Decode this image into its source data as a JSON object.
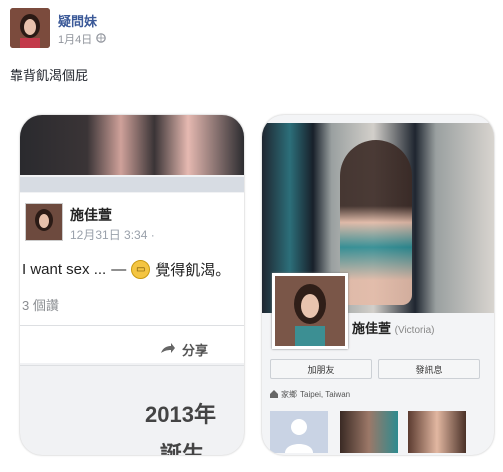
{
  "post": {
    "author": "疑問妹",
    "date": "1月4日",
    "text": "靠背飢渴個屁"
  },
  "left_screenshot": {
    "name": "施佳萱",
    "date": "12月31日 3:34 ·",
    "status": "I want sex ...",
    "dash": "—",
    "feeling": "覺得飢渴。",
    "likes": "3 個讚",
    "share": "分享",
    "year": "2013年",
    "birth": "誕生"
  },
  "right_screenshot": {
    "name": "施佳萱",
    "name_en": "(Victoria)",
    "add_friend": "加朋友",
    "message": "發訊息",
    "hometown_prefix": "家鄉",
    "hometown": "Taipei, Taiwan"
  },
  "colors": {
    "link": "#3b5998",
    "meta": "#90949c"
  }
}
